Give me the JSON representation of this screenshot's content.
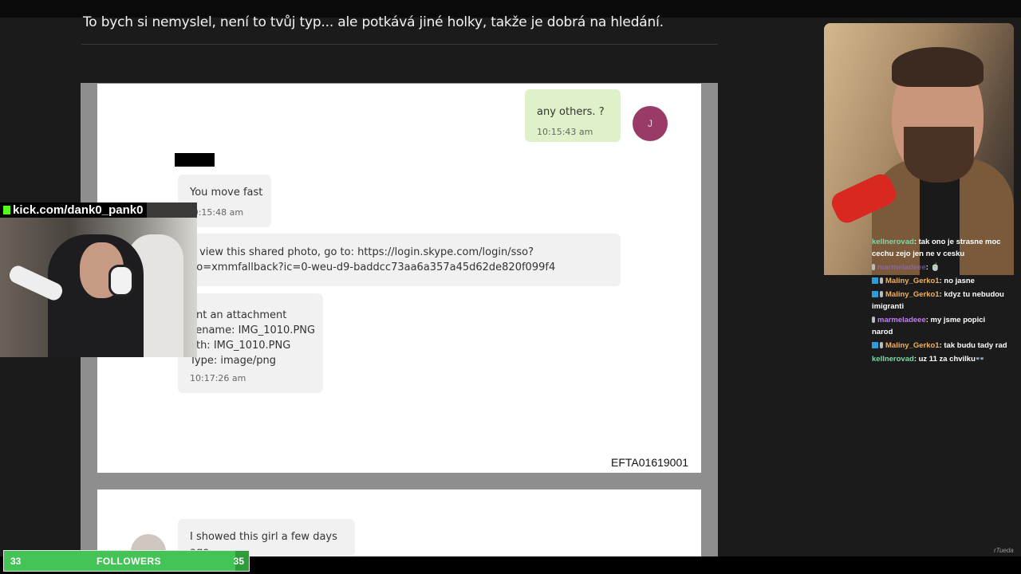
{
  "translation": "To bych si nemyslel, není to tvůj typ... ale potkává jiné holky, takže je dobrá na hledání.",
  "document": {
    "sent": {
      "message": "any others. ?",
      "time": "10:15:43 am",
      "avatar_initial": "J"
    },
    "received": [
      {
        "message": "You move fast",
        "time": ":0:15:48 am"
      },
      {
        "message": "o view this shared photo, go to: https://login.skype.com/login/sso?go=xmmfallback?ic=0-weu-d9-baddcc73aa6a357a45d62de820f099f4"
      },
      {
        "line1": "ent an attachment",
        "line2": "ilename: IMG_1010.PNG",
        "line3": "ath: IMG_1010.PNG",
        "line4": "Type: image/png",
        "time": "10:17:26 am"
      }
    ],
    "doc_id": "EFTA01619001",
    "page2": {
      "message": "I showed this girl a few days ago"
    }
  },
  "webcam_label": "kick.com/dank0_pank0",
  "chat": [
    {
      "user": "kellnerovad",
      "text": ": tak ono je strasne moc cechu zejo jen ne v cesku",
      "color": "#7fd8a8"
    },
    {
      "user": "marmeladeee",
      "text": ": 🍵",
      "color": "#9b6fd6"
    },
    {
      "user": "Maliny_Gerko1",
      "text": ": no jasne",
      "color": "#f0b060"
    },
    {
      "user": "Maliny_Gerko1",
      "text": ": kdyz tu nebudou imigranti",
      "color": "#f0b060"
    },
    {
      "user": "marmeladeee",
      "text": ": my jsme popici narod",
      "color": "#c47ef5"
    },
    {
      "user": "Maliny_Gerko1",
      "text": ": tak budu tady rad",
      "color": "#f0b060"
    },
    {
      "user": "kellnerovad",
      "text": ": uz 11 za chvilku👓",
      "color": "#7fd8a8"
    }
  ],
  "followers": {
    "current": "33",
    "label": "FOLLOWERS",
    "goal": "35",
    "progress": 0.943
  },
  "watermark": "rTueda"
}
